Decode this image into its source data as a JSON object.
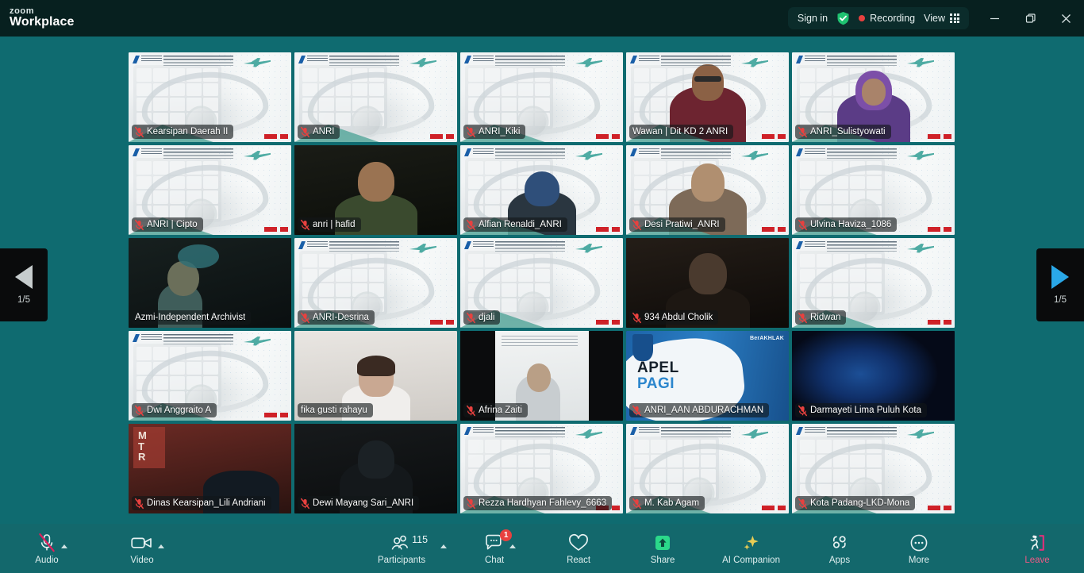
{
  "app": {
    "brand_top": "zoom",
    "brand_bottom": "Workplace"
  },
  "titlebar": {
    "sign_in": "Sign in",
    "shield_icon": "shield-check-icon",
    "recording_label": "Recording",
    "recording_dot_color": "#e8413f",
    "view_label": "View",
    "view_icon": "grid-icon",
    "minimize_icon": "minimize-icon",
    "restore_icon": "restore-icon",
    "close_icon": "close-icon"
  },
  "pagination": {
    "prev_icon": "triangle-left-icon",
    "next_icon": "triangle-right-icon",
    "prev_label": "1/5",
    "next_label": "1/5",
    "prev_color": "#c6cccd",
    "next_color": "#2aa8e8"
  },
  "gallery": {
    "active_border_color": "#23d07a",
    "rows": 5,
    "cols": 5,
    "tiles": [
      {
        "name": "Kearsipan Daerah II",
        "muted": true,
        "active": false,
        "bg": "slide"
      },
      {
        "name": "ANRI",
        "muted": true,
        "active": false,
        "bg": "slide"
      },
      {
        "name": "ANRI_Kiki",
        "muted": true,
        "active": false,
        "bg": "slide"
      },
      {
        "name": "Wawan | Dit KD 2 ANRI",
        "muted": false,
        "active": true,
        "bg": "person-speaker"
      },
      {
        "name": "ANRI_Sulistyowati",
        "muted": true,
        "active": false,
        "bg": "person-hijab-purple"
      },
      {
        "name": "ANRI | Cipto",
        "muted": true,
        "active": false,
        "bg": "slide"
      },
      {
        "name": "anri | hafid",
        "muted": true,
        "active": false,
        "bg": "person-dark-green"
      },
      {
        "name": "Alfian Renaldi_ANRI",
        "muted": true,
        "active": false,
        "bg": "person-blue-cap"
      },
      {
        "name": "Desi Pratiwi_ANRI",
        "muted": true,
        "active": false,
        "bg": "person-beige"
      },
      {
        "name": "Ulvina Haviza_1086",
        "muted": true,
        "active": false,
        "bg": "slide"
      },
      {
        "name": "Azmi-Independent Archivist",
        "muted": false,
        "active": false,
        "bg": "person-dark-teal"
      },
      {
        "name": "ANRI-Desrina",
        "muted": true,
        "active": false,
        "bg": "slide"
      },
      {
        "name": "djali",
        "muted": true,
        "active": false,
        "bg": "slide"
      },
      {
        "name": "934 Abdul Cholik",
        "muted": true,
        "active": false,
        "bg": "person-dark-brown"
      },
      {
        "name": "Ridwan",
        "muted": true,
        "active": false,
        "bg": "slide"
      },
      {
        "name": "Dwi Anggraito A",
        "muted": true,
        "active": false,
        "bg": "slide"
      },
      {
        "name": "fika gusti rahayu",
        "muted": false,
        "active": false,
        "bg": "person-light-room"
      },
      {
        "name": "Afrina Zaiti",
        "muted": true,
        "active": false,
        "bg": "person-doc-dark"
      },
      {
        "name": "ANRI_AAN ABDURACHMAN",
        "muted": true,
        "active": false,
        "bg": "apel-pagi"
      },
      {
        "name": "Darmayeti Lima Puluh Kota",
        "muted": true,
        "active": false,
        "bg": "blue-dark"
      },
      {
        "name": "Dinas Kearsipan_Lili Andriani",
        "muted": true,
        "active": false,
        "bg": "person-red-wall"
      },
      {
        "name": "Dewi Mayang Sari_ANRI",
        "muted": true,
        "active": false,
        "bg": "person-dark-hijab"
      },
      {
        "name": "Rezza Hardhyan Fahlevy_6663",
        "muted": true,
        "active": false,
        "bg": "slide"
      },
      {
        "name": "M. Kab Agam",
        "muted": true,
        "active": false,
        "bg": "slide"
      },
      {
        "name": "Kota Padang-LKD-Mona",
        "muted": true,
        "active": false,
        "bg": "slide"
      }
    ]
  },
  "slide": {
    "headline": "Focus Group Discussion",
    "subline": "Evaluasi Pembangunan Pengelolaan Arsip Terjaga",
    "plane_color": "#3fa49b"
  },
  "apel_slide": {
    "line1": "APEL",
    "line2": "PAGI",
    "badge": "BerAKHLAK"
  },
  "toolbar": {
    "audio": {
      "label": "Audio",
      "icon": "microphone-muted-icon",
      "has_caret": true
    },
    "video": {
      "label": "Video",
      "icon": "camera-icon",
      "has_caret": true
    },
    "participants": {
      "label": "Participants",
      "icon": "people-icon",
      "count": "115",
      "has_caret": true
    },
    "chat": {
      "label": "Chat",
      "icon": "chat-bubble-icon",
      "badge": "1",
      "has_caret": true
    },
    "react": {
      "label": "React",
      "icon": "heart-icon"
    },
    "share": {
      "label": "Share",
      "icon": "share-screen-icon",
      "color": "#2bd98a"
    },
    "ai": {
      "label": "AI Companion",
      "icon": "sparkle-icon",
      "color": "#e8cc54"
    },
    "apps": {
      "label": "Apps",
      "icon": "apps-icon"
    },
    "more": {
      "label": "More",
      "icon": "ellipsis-icon"
    },
    "leave": {
      "label": "Leave",
      "icon": "leave-door-icon",
      "color": "#f05a86"
    }
  }
}
